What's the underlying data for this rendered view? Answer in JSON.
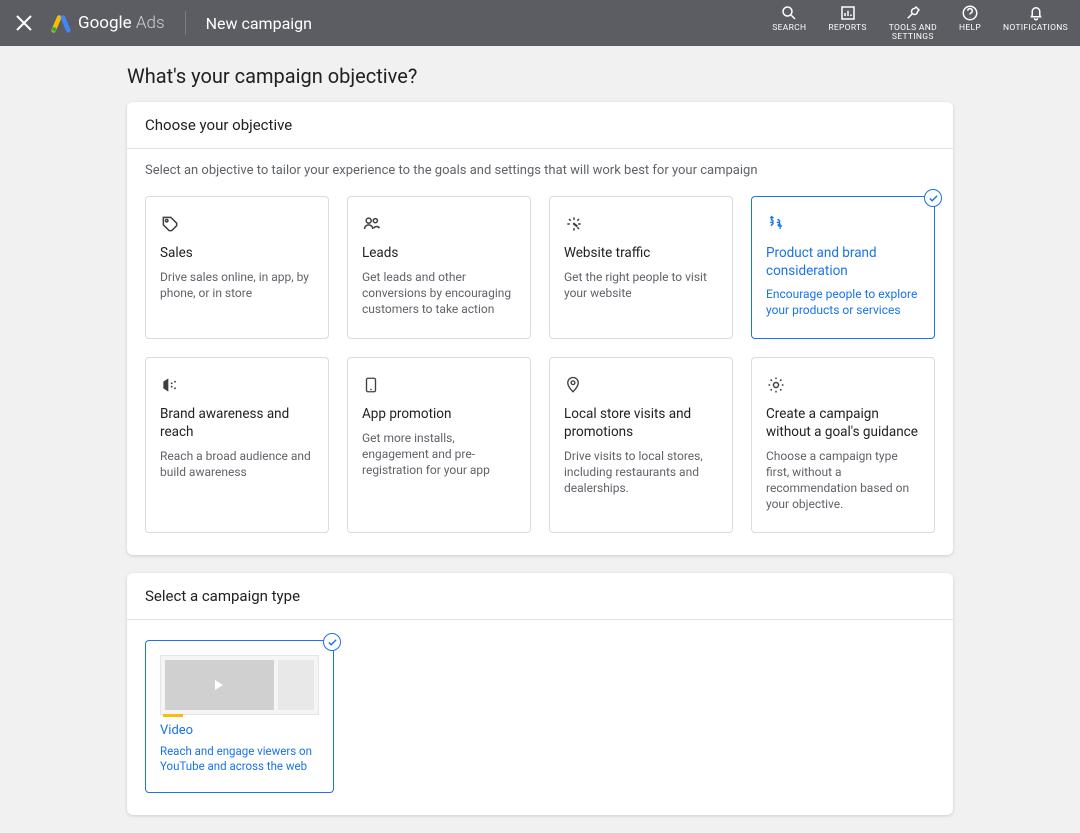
{
  "topbar": {
    "brand_google": "Google",
    "brand_ads": "Ads",
    "page_title": "New campaign",
    "items": [
      {
        "label": "SEARCH"
      },
      {
        "label": "REPORTS"
      },
      {
        "label": "TOOLS AND\nSETTINGS"
      },
      {
        "label": "HELP"
      },
      {
        "label": "NOTIFICATIONS"
      }
    ]
  },
  "heading": "What's your campaign objective?",
  "objective": {
    "header": "Choose your objective",
    "sub": "Select an objective to tailor your experience to the goals and settings that will work best for your campaign",
    "cards": [
      {
        "title": "Sales",
        "desc": "Drive sales online, in app, by phone, or in store",
        "selected": false
      },
      {
        "title": "Leads",
        "desc": "Get leads and other conversions by encouraging customers to take action",
        "selected": false
      },
      {
        "title": "Website traffic",
        "desc": "Get the right people to visit your website",
        "selected": false
      },
      {
        "title": "Product and brand consideration",
        "desc": "Encourage people to explore your products or services",
        "selected": true
      },
      {
        "title": "Brand awareness and reach",
        "desc": "Reach a broad audience and build awareness",
        "selected": false
      },
      {
        "title": "App promotion",
        "desc": "Get more installs, engagement and pre-registration for your app",
        "selected": false
      },
      {
        "title": "Local store visits and promotions",
        "desc": "Drive visits to local stores, including restaurants and dealerships.",
        "selected": false
      },
      {
        "title": "Create a campaign without a goal's guidance",
        "desc": "Choose a campaign type first, without a recommendation based on your objective.",
        "selected": false
      }
    ]
  },
  "campaign_type": {
    "header": "Select a campaign type",
    "cards": [
      {
        "title": "Video",
        "desc": "Reach and engage viewers on YouTube and across the web",
        "selected": true
      }
    ]
  }
}
